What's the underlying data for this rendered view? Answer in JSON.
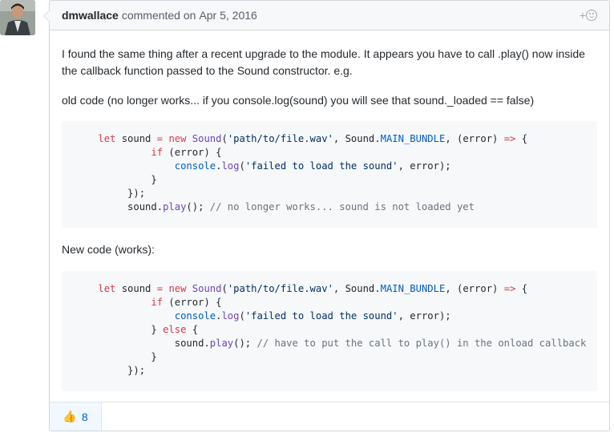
{
  "comment": {
    "author": "dmwallace",
    "action": "commented on",
    "date": "Apr 5, 2016",
    "add_reaction": "+",
    "paragraphs": [
      "I found the same thing after a recent upgrade to the module. It appears you have to call .play() now inside the callback function passed to the Sound constructor. e.g.",
      "old code (no longer works... if you console.log(sound) you will see that sound._loaded == false)",
      "New code (works):"
    ],
    "reactions": [
      {
        "emoji": "👍",
        "count": "8"
      }
    ]
  }
}
